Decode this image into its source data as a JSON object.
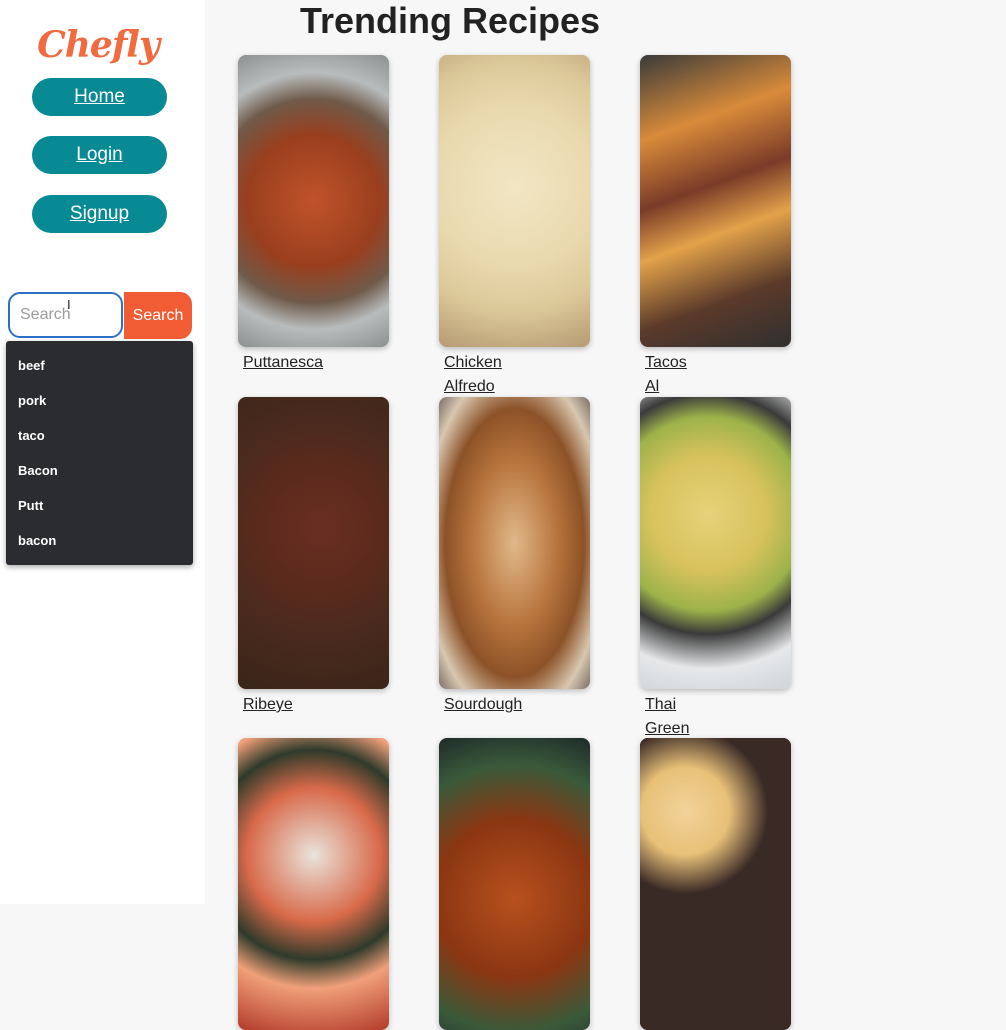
{
  "brand": {
    "logo": "Chefly",
    "accent": "#f26a3f",
    "nav_color": "#078a93"
  },
  "nav": {
    "home": "Home",
    "login": "Login",
    "signup": "Signup"
  },
  "search": {
    "placeholder": "Search",
    "button": "Search",
    "suggestions": [
      "beef",
      "pork",
      "taco",
      "Bacon",
      "Putt",
      "bacon"
    ]
  },
  "page": {
    "title": "Trending Recipes"
  },
  "recipes": [
    {
      "lines": [
        "Puttanesca"
      ]
    },
    {
      "lines": [
        "Chicken",
        "Alfredo"
      ]
    },
    {
      "lines": [
        "Tacos",
        "Al"
      ]
    },
    {
      "lines": [
        "Ribeye"
      ]
    },
    {
      "lines": [
        "Sourdough"
      ]
    },
    {
      "lines": [
        "Thai",
        "Green"
      ]
    },
    {
      "lines": []
    },
    {
      "lines": []
    },
    {
      "lines": []
    }
  ]
}
